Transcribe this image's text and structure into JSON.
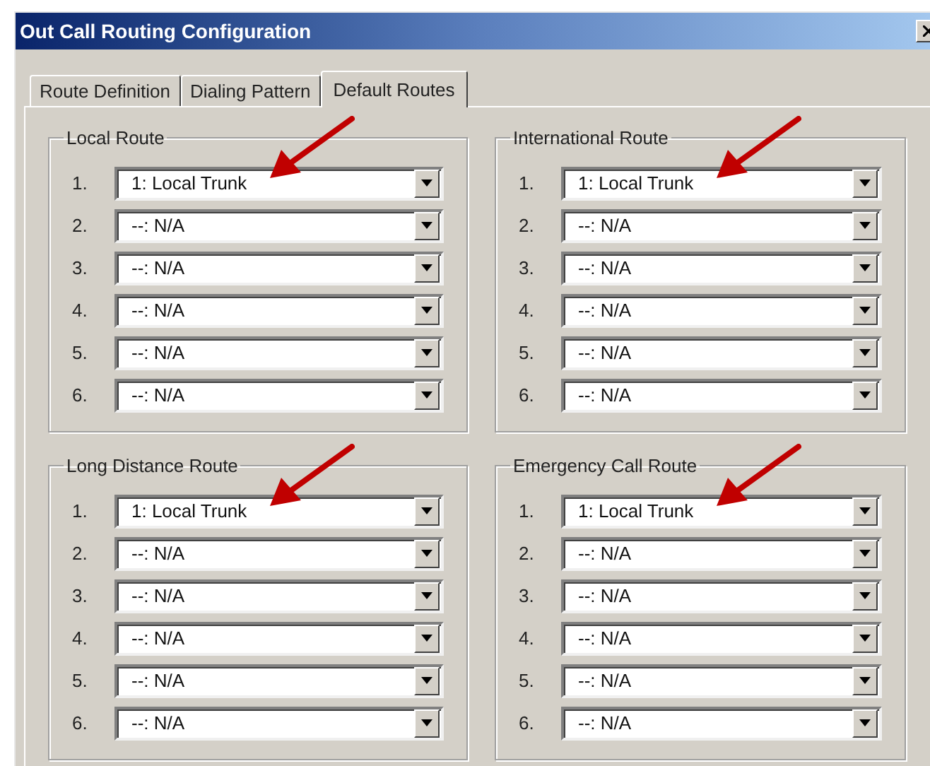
{
  "window": {
    "title": "Out Call Routing Configuration"
  },
  "tabs": [
    {
      "label": "Route Definition",
      "selected": false
    },
    {
      "label": "Dialing Pattern",
      "selected": false
    },
    {
      "label": "Default Routes",
      "selected": true
    }
  ],
  "groups": [
    {
      "title": "Local Route",
      "rows": [
        {
          "number": "1.",
          "value": "1: Local Trunk",
          "highlighted": true
        },
        {
          "number": "2.",
          "value": "--: N/A",
          "highlighted": false
        },
        {
          "number": "3.",
          "value": "--: N/A",
          "highlighted": false
        },
        {
          "number": "4.",
          "value": "--: N/A",
          "highlighted": false
        },
        {
          "number": "5.",
          "value": "--: N/A",
          "highlighted": false
        },
        {
          "number": "6.",
          "value": "--: N/A",
          "highlighted": false
        }
      ]
    },
    {
      "title": "International Route",
      "rows": [
        {
          "number": "1.",
          "value": "1: Local Trunk",
          "highlighted": true
        },
        {
          "number": "2.",
          "value": "--: N/A",
          "highlighted": false
        },
        {
          "number": "3.",
          "value": "--: N/A",
          "highlighted": false
        },
        {
          "number": "4.",
          "value": "--: N/A",
          "highlighted": false
        },
        {
          "number": "5.",
          "value": "--: N/A",
          "highlighted": false
        },
        {
          "number": "6.",
          "value": "--: N/A",
          "highlighted": false
        }
      ]
    },
    {
      "title": "Long Distance Route",
      "rows": [
        {
          "number": "1.",
          "value": "1: Local Trunk",
          "highlighted": true
        },
        {
          "number": "2.",
          "value": "--: N/A",
          "highlighted": false
        },
        {
          "number": "3.",
          "value": "--: N/A",
          "highlighted": false
        },
        {
          "number": "4.",
          "value": "--: N/A",
          "highlighted": false
        },
        {
          "number": "5.",
          "value": "--: N/A",
          "highlighted": false
        },
        {
          "number": "6.",
          "value": "--: N/A",
          "highlighted": false
        }
      ]
    },
    {
      "title": "Emergency Call Route",
      "rows": [
        {
          "number": "1.",
          "value": "1: Local Trunk",
          "highlighted": true
        },
        {
          "number": "2.",
          "value": "--: N/A",
          "highlighted": false
        },
        {
          "number": "3.",
          "value": "--: N/A",
          "highlighted": false
        },
        {
          "number": "4.",
          "value": "--: N/A",
          "highlighted": false
        },
        {
          "number": "5.",
          "value": "--: N/A",
          "highlighted": false
        },
        {
          "number": "6.",
          "value": "--: N/A",
          "highlighted": false
        }
      ]
    }
  ]
}
